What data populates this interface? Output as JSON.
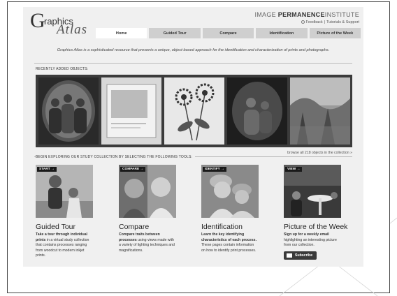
{
  "header": {
    "logo_g": "G",
    "logo_raphics": "raphics",
    "logo_atlas": "Atlas",
    "institute_prefix": "IMAGE",
    "institute_bold": "PERMANENCE",
    "institute_suffix": "INSTITUTE",
    "feedback_label": "Feedback",
    "tutorials_label": "Tutorials & Support"
  },
  "nav": {
    "tabs": [
      {
        "label": "Home",
        "active": true
      },
      {
        "label": "Guided Tour"
      },
      {
        "label": "Compare"
      },
      {
        "label": "Identification"
      },
      {
        "label": "Picture of the Week"
      }
    ]
  },
  "intro": "Graphics Atlas is a sophisticated resource that presents a unique, object-based approach for the identification and characterization of prints and photographs.",
  "recent": {
    "heading": "RECENTLY ADDED OBJECTS:",
    "browse_link": "browse all 218 objects in the collection »"
  },
  "explore": {
    "heading": "BEGIN EXPLORING OUR STUDY COLLECTION BY SELECTING THE FOLLOWING TOOLS:",
    "tools": [
      {
        "tag": "START →",
        "title": "Guided Tour",
        "desc_bold": "Take a tour through individual prints",
        "desc_rest": " in a virtual study collection that contains processes ranging from woodcut to modern inkjet prints."
      },
      {
        "tag": "COMPARE →",
        "title": "Compare",
        "desc_bold": "Compare traits between processes",
        "desc_rest": " using views made with a variety of lighting techniques and magnifications."
      },
      {
        "tag": "IDENTIFY →",
        "title": "Identification",
        "desc_bold": "Learn the key identifying characteristics of each process.",
        "desc_rest": " These pages contain information on how to identify print processes."
      },
      {
        "tag": "VIEW →",
        "title": "Picture of the Week",
        "desc_bold": "Sign up for a weekly email",
        "desc_rest": " highlighting an interesting picture from our collection.",
        "button_label": "Subscribe"
      }
    ]
  }
}
